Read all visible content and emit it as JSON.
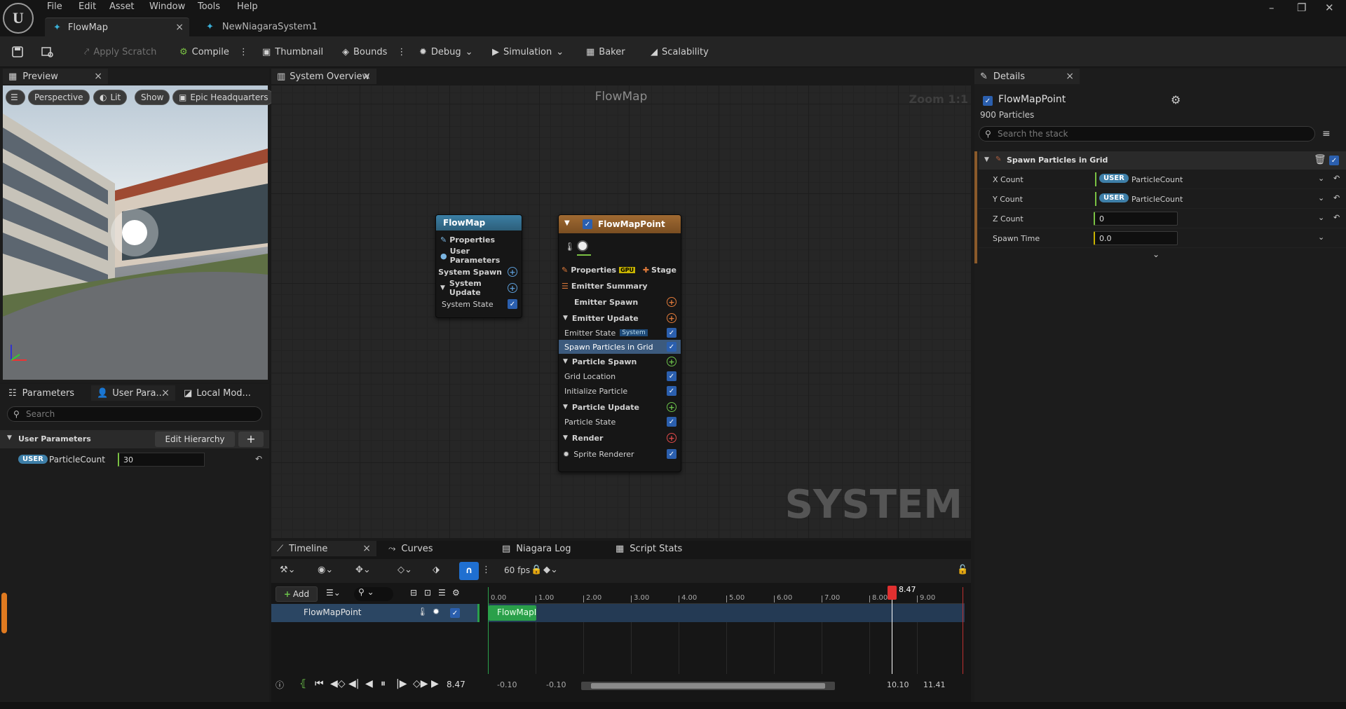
{
  "menu": [
    "File",
    "Edit",
    "Asset",
    "Window",
    "Tools",
    "Help"
  ],
  "tabs": [
    {
      "label": "FlowMap"
    },
    {
      "label": "NewNiagaraSystem1"
    }
  ],
  "toolbar": {
    "apply_scratch": "Apply Scratch",
    "compile": "Compile",
    "thumbnail": "Thumbnail",
    "bounds": "Bounds",
    "debug": "Debug",
    "simulation": "Simulation",
    "baker": "Baker",
    "scalability": "Scalability"
  },
  "preview": {
    "tab": "Preview",
    "perspective": "Perspective",
    "lit": "Lit",
    "show": "Show",
    "location": "Epic Headquarters"
  },
  "params": {
    "tabs": [
      "Parameters",
      "User Para...",
      "Local Mod..."
    ],
    "search_placeholder": "Search",
    "section": "User Parameters",
    "edit_hierarchy": "Edit Hierarchy",
    "badge": "USER",
    "param_name": "ParticleCount",
    "param_value": "30"
  },
  "graph": {
    "tab": "System Overview",
    "title": "FlowMap",
    "zoom": "Zoom 1:1",
    "watermark": "SYSTEM",
    "system_node": {
      "title": "FlowMap",
      "rows": [
        "Properties",
        "User Parameters",
        "System Spawn",
        "System Update",
        "System State"
      ]
    },
    "emitter_node": {
      "title": "FlowMapPoint",
      "properties": "Properties",
      "gpu": "GPU",
      "stage": "Stage",
      "summary": "Emitter Summary",
      "emitter_spawn": "Emitter Spawn",
      "emitter_update": "Emitter Update",
      "emitter_state": "Emitter State",
      "system_tag": "System",
      "spawn_grid": "Spawn Particles in Grid",
      "particle_spawn": "Particle Spawn",
      "grid_location": "Grid Location",
      "init_particle": "Initialize Particle",
      "particle_update": "Particle Update",
      "particle_state": "Particle State",
      "render": "Render",
      "sprite_renderer": "Sprite Renderer"
    }
  },
  "details": {
    "tab": "Details",
    "emitter": "FlowMapPoint",
    "particles": "900 Particles",
    "search_placeholder": "Search the stack",
    "section": "Spawn Particles in Grid",
    "rows": [
      {
        "label": "X Count",
        "badge": "USER",
        "value": "ParticleCount"
      },
      {
        "label": "Y Count",
        "badge": "USER",
        "value": "ParticleCount"
      },
      {
        "label": "Z Count",
        "value": "0"
      },
      {
        "label": "Spawn Time",
        "value": "0.0"
      }
    ]
  },
  "bottom_tabs": [
    "Timeline",
    "Curves",
    "Niagara Log",
    "Script Stats"
  ],
  "timeline": {
    "fps": "60 fps",
    "add": "Add",
    "track": "FlowMapPoint",
    "bar_label": "FlowMapI",
    "playhead": "8.47",
    "ticks": [
      "0.00",
      "1.00",
      "2.00",
      "3.00",
      "4.00",
      "5.00",
      "6.00",
      "7.00",
      "8.00",
      "9.00"
    ],
    "current": "8.47",
    "range_start_a": "-0.10",
    "range_start_b": "-0.10",
    "range_end_a": "10.10",
    "range_end_b": "11.41"
  },
  "colors": {
    "accent": "#2b5fae",
    "user_badge": "#3e7fa8",
    "emitter_header": "#8a5a2a",
    "system_header": "#2d5f7a",
    "playhead": "#e03030",
    "track_bar": "#2aa04a"
  }
}
